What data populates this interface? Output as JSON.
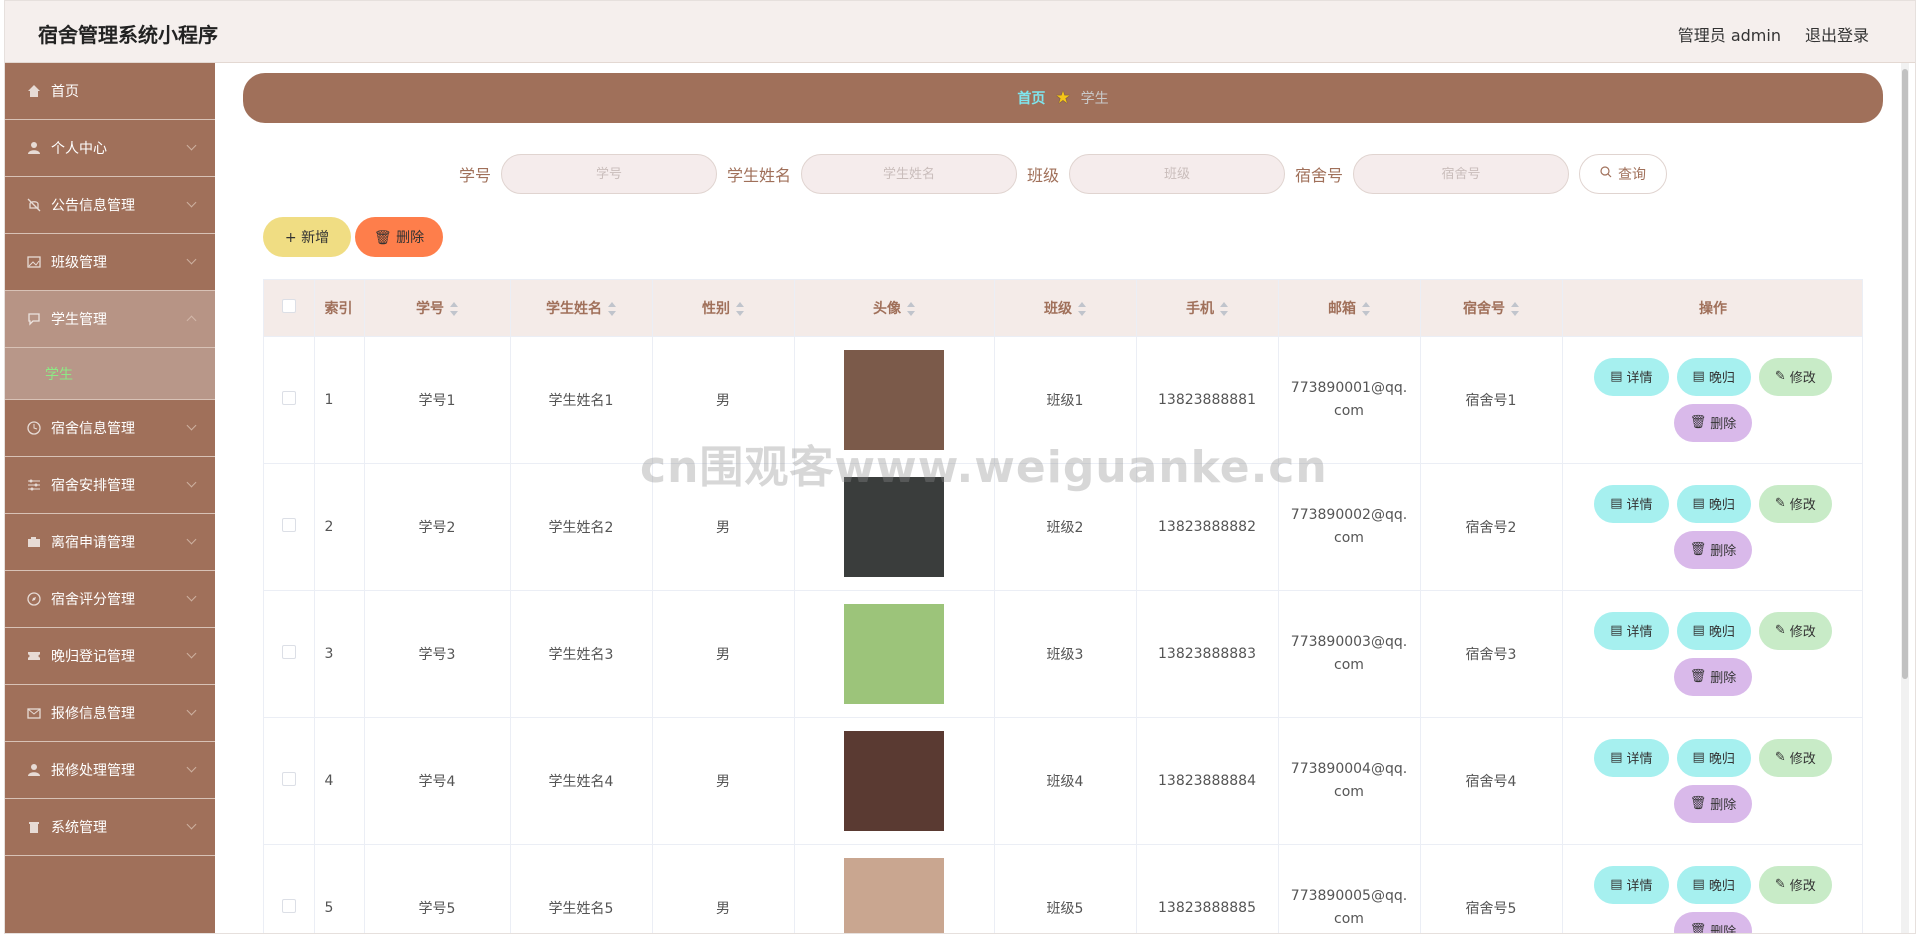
{
  "app": {
    "title": "宿舍管理系统小程序",
    "user_label": "管理员 admin",
    "logout_label": "退出登录"
  },
  "sidebar": {
    "items": [
      {
        "label": "首页",
        "icon": "home-icon"
      },
      {
        "label": "个人中心",
        "icon": "user-icon"
      },
      {
        "label": "公告信息管理",
        "icon": "bell-off-icon"
      },
      {
        "label": "班级管理",
        "icon": "picture-icon"
      },
      {
        "label": "学生管理",
        "icon": "chat-icon"
      },
      {
        "label": "宿舍信息管理",
        "icon": "clock-icon"
      },
      {
        "label": "宿舍安排管理",
        "icon": "sliders-icon"
      },
      {
        "label": "离宿申请管理",
        "icon": "camera-icon"
      },
      {
        "label": "宿舍评分管理",
        "icon": "compass-icon"
      },
      {
        "label": "晚归登记管理",
        "icon": "ticket-icon"
      },
      {
        "label": "报修信息管理",
        "icon": "mail-icon"
      },
      {
        "label": "报修处理管理",
        "icon": "user-icon"
      },
      {
        "label": "系统管理",
        "icon": "trash-icon"
      }
    ],
    "sub_item": "学生"
  },
  "breadcrumb": {
    "home": "首页",
    "current": "学生"
  },
  "search": {
    "fields": [
      {
        "label": "学号",
        "placeholder": "学号"
      },
      {
        "label": "学生姓名",
        "placeholder": "学生姓名"
      },
      {
        "label": "班级",
        "placeholder": "班级"
      },
      {
        "label": "宿舍号",
        "placeholder": "宿舍号"
      }
    ],
    "query_label": "查询"
  },
  "toolbar": {
    "add_label": "新增",
    "delete_label": "删除"
  },
  "table": {
    "headers": [
      "索引",
      "学号",
      "学生姓名",
      "性别",
      "头像",
      "班级",
      "手机",
      "邮箱",
      "宿舍号",
      "操作"
    ],
    "rows": [
      {
        "index": "1",
        "student_id": "学号1",
        "name": "学生姓名1",
        "gender": "男",
        "class": "班级1",
        "phone": "13823888881",
        "email": "773890001@qq.com",
        "dorm": "宿舍号1",
        "avatar_color": "#7b5a4a"
      },
      {
        "index": "2",
        "student_id": "学号2",
        "name": "学生姓名2",
        "gender": "男",
        "class": "班级2",
        "phone": "13823888882",
        "email": "773890002@qq.com",
        "dorm": "宿舍号2",
        "avatar_color": "#3a3d3c"
      },
      {
        "index": "3",
        "student_id": "学号3",
        "name": "学生姓名3",
        "gender": "男",
        "class": "班级3",
        "phone": "13823888883",
        "email": "773890003@qq.com",
        "dorm": "宿舍号3",
        "avatar_color": "#9cc47a"
      },
      {
        "index": "4",
        "student_id": "学号4",
        "name": "学生姓名4",
        "gender": "男",
        "class": "班级4",
        "phone": "13823888884",
        "email": "773890004@qq.com",
        "dorm": "宿舍号4",
        "avatar_color": "#5a3a32"
      },
      {
        "index": "5",
        "student_id": "学号5",
        "name": "学生姓名5",
        "gender": "男",
        "class": "班级5",
        "phone": "13823888885",
        "email": "773890005@qq.com",
        "dorm": "宿舍号5",
        "avatar_color": "#c9a690"
      }
    ],
    "actions": {
      "detail": "详情",
      "late": "晚归",
      "edit": "修改",
      "remove": "删除"
    }
  },
  "watermark": "cn围观客www.weiguanke.cn",
  "colors": {
    "brand": "#a0705a",
    "topbar": "#f5efed",
    "accent": "#7fe5ee",
    "active_sub": "#8dea84"
  }
}
